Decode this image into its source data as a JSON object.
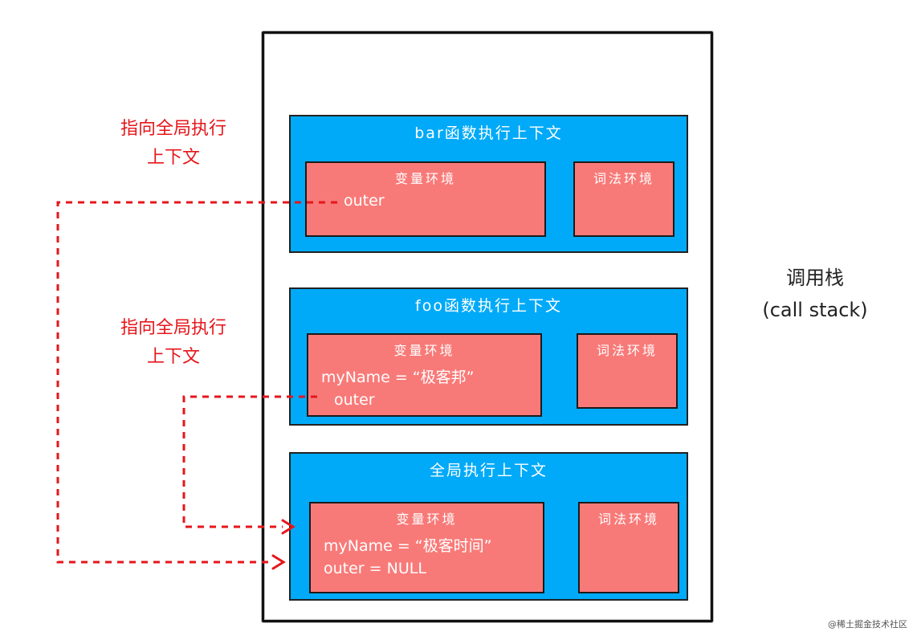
{
  "diagram": {
    "call_stack_label": {
      "line1": "调用栈",
      "line2": "(call stack)"
    },
    "pointer_labels": [
      {
        "line1": "指向全局执行",
        "line2": "上下文"
      },
      {
        "line1": "指向全局执行",
        "line2": "上下文"
      }
    ],
    "contexts": [
      {
        "title": "bar函数执行上下文",
        "variable_env": {
          "title": "变量环境",
          "lines": [
            "outer"
          ]
        },
        "lexical_env": {
          "title": "词法环境"
        }
      },
      {
        "title": "foo函数执行上下文",
        "variable_env": {
          "title": "变量环境",
          "lines": [
            "myName = “极客邦”",
            "outer"
          ]
        },
        "lexical_env": {
          "title": "词法环境"
        }
      },
      {
        "title": "全局执行上下文",
        "variable_env": {
          "title": "变量环境",
          "lines": [
            "myName = “极客时间”",
            "outer = NULL"
          ]
        },
        "lexical_env": {
          "title": "词法环境"
        }
      }
    ],
    "colors": {
      "context_fill": "#00aaf8",
      "environment_fill": "#f87a78",
      "pointer_arrow": "#e5161b"
    },
    "watermark": "@稀土掘金技术社区"
  }
}
